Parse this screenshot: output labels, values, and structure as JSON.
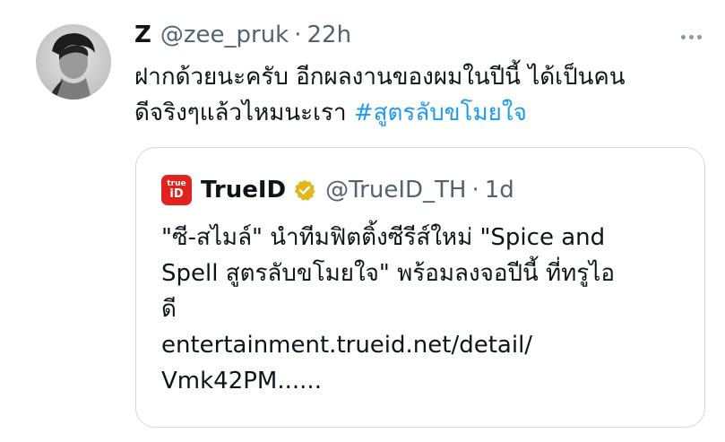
{
  "tweet": {
    "author_name": "Z",
    "author_handle": "@zee_pruk",
    "separator": "·",
    "time": "22h",
    "text_line1": "ฝากด้วยนะครับ อีกผลงานของผมในปีนี้ ได้เป็นคน",
    "text_line2": "ดีจริงๆแล้วไหมนะเรา ",
    "hashtag": "#สูตรลับขโมยใจ",
    "avatar_icon": "profile-photo",
    "more_icon": "more-options-icon"
  },
  "quoted_tweet": {
    "logo_text_top": "true",
    "logo_text_bottom": "iD",
    "author_name": "TrueID",
    "verified_icon": "verified-badge-icon",
    "author_handle": "@TrueID_TH",
    "separator": "·",
    "time": "1d",
    "lines": [
      "\"ซี-สไมล์\" นำทีมฟิตติ้งซีรีส์ใหม่ \"Spice and",
      "Spell สูตรลับขโมยใจ\" พร้อมลงจอปีนี้ ที่ทรูไอ",
      "ดี",
      "entertainment.trueid.net/detail/",
      "Vmk42PM......"
    ]
  },
  "colors": {
    "text": "#0f1419",
    "secondary": "#536471",
    "link": "#1d9bf0",
    "border": "#cfd9de",
    "verified_gold": "#e2b719",
    "trueid_red": "#e0231c"
  }
}
